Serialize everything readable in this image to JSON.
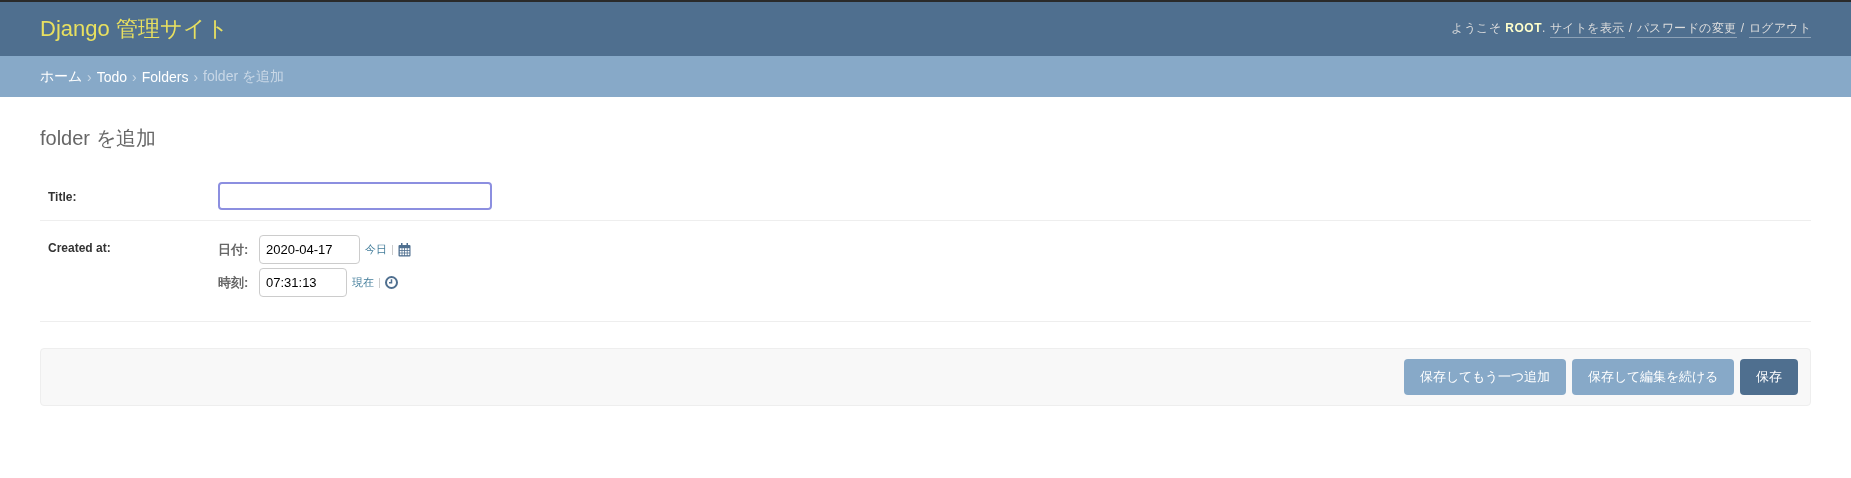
{
  "header": {
    "site_title": "Django 管理サイト",
    "welcome": "ようこそ **ROOT**.",
    "links": [
      "サイトを表示",
      "パスワードの変更",
      "ログアウト"
    ],
    "separator": "/"
  },
  "breadcrumbs": {
    "items": [
      "ホーム",
      "Todo",
      "Folders"
    ],
    "current": "folder を追加",
    "separator": "›"
  },
  "page_title": "folder を追加",
  "fields": [
    {
      "kind": "text",
      "label": "Title:",
      "focused": true
    },
    {
      "kind": "datetime",
      "label": "Created at:",
      "parts": [
        {
          "kind": "date",
          "label": "日付:",
          "value": "2020-04-17",
          "shortcut": "今日"
        },
        {
          "kind": "time",
          "label": "時刻:",
          "value": "07:31:13",
          "shortcut": "現在"
        }
      ]
    }
  ],
  "buttons": [
    {
      "label": "保存してもう一つ追加",
      "kind": "secondary"
    },
    {
      "label": "保存して編集を続ける",
      "kind": "secondary"
    },
    {
      "label": "保存",
      "kind": "primary"
    }
  ]
}
